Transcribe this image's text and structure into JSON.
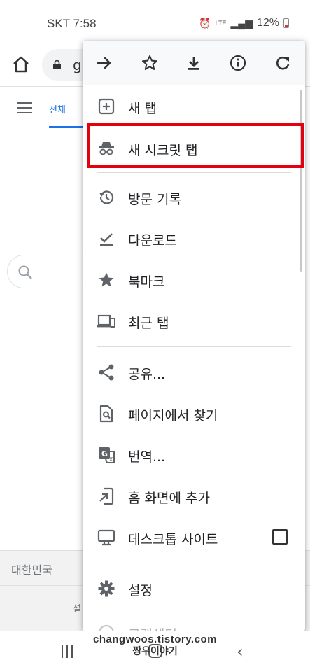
{
  "status_bar": {
    "carrier_time": "SKT 7:58",
    "network": "LTE",
    "battery": "12%"
  },
  "toolbar": {
    "url_fragment": "g"
  },
  "page": {
    "tab_all": "전체",
    "region": "대한민국",
    "footer_link": "설"
  },
  "menu": {
    "icon_row": [
      "arrow-forward-icon",
      "star-outline-icon",
      "download-icon",
      "info-icon",
      "reload-icon"
    ],
    "items": [
      {
        "label": "새 탭",
        "icon": "new-tab-icon"
      },
      {
        "label": "새 시크릿 탭",
        "icon": "incognito-icon"
      },
      {
        "label": "방문 기록",
        "icon": "history-icon"
      },
      {
        "label": "다운로드",
        "icon": "downloads-check-icon"
      },
      {
        "label": "북마크",
        "icon": "bookmark-star-icon"
      },
      {
        "label": "최근 탭",
        "icon": "recent-tabs-icon"
      },
      {
        "label": "공유...",
        "icon": "share-icon"
      },
      {
        "label": "페이지에서 찾기",
        "icon": "find-in-page-icon"
      },
      {
        "label": "번역...",
        "icon": "translate-icon"
      },
      {
        "label": "홈 화면에 추가",
        "icon": "add-to-home-icon"
      },
      {
        "label": "데스크톱 사이트",
        "icon": "desktop-icon",
        "checked": false
      },
      {
        "label": "설정",
        "icon": "settings-gear-icon"
      },
      {
        "label": "고객센터",
        "icon": "help-icon"
      }
    ],
    "highlighted_item": "새 시크릿 탭",
    "highlight_color": "#e3000f"
  },
  "watermark": {
    "line1": "changwoos.tistory.com",
    "line2": "짱우이야기"
  }
}
